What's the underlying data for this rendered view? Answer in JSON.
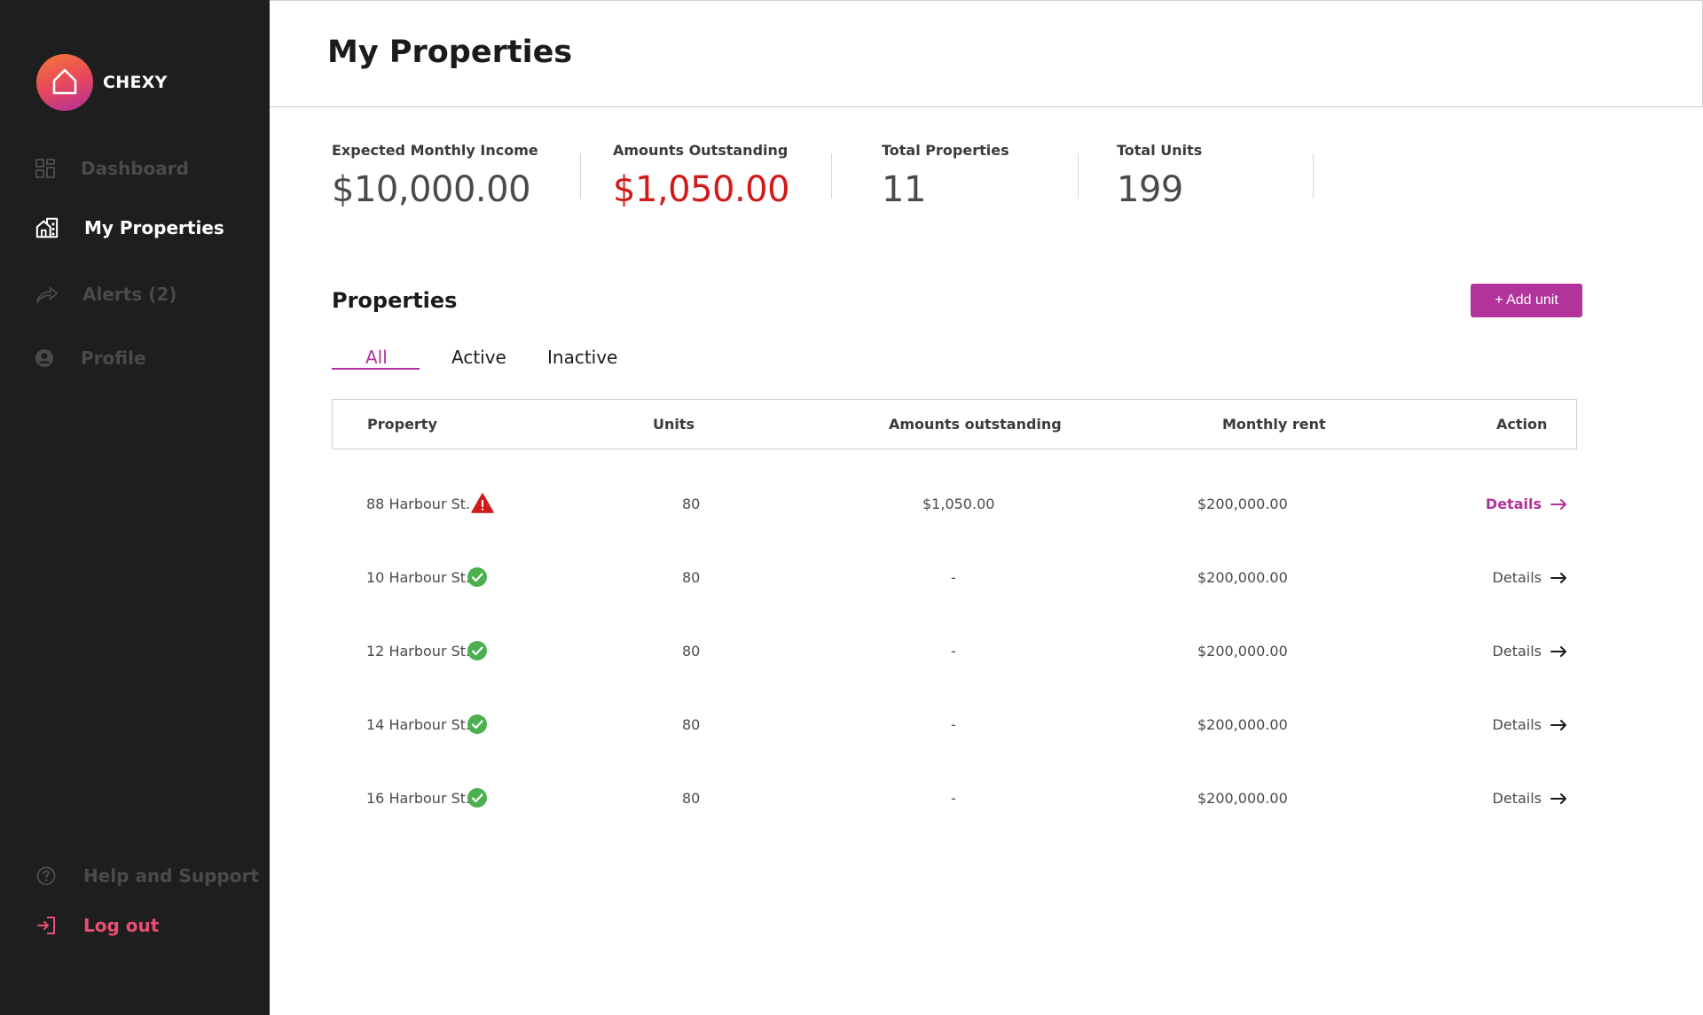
{
  "brand": {
    "name": "CHEXY"
  },
  "sidebar": {
    "items": [
      {
        "label": "Dashboard",
        "icon": "dashboard-icon"
      },
      {
        "label": "My Properties",
        "icon": "building-icon",
        "active": true
      },
      {
        "label": "Alerts (2)",
        "icon": "share-arrow-icon"
      },
      {
        "label": "Profile",
        "icon": "user-icon"
      }
    ],
    "footer": [
      {
        "label": "Help and Support",
        "icon": "help-icon"
      },
      {
        "label": "Log out",
        "icon": "logout-icon"
      }
    ]
  },
  "header": {
    "title": "My Properties"
  },
  "stats": [
    {
      "label": "Expected Monthly Income",
      "value": "$10,000.00"
    },
    {
      "label": "Amounts Outstanding",
      "value": "$1,050.00"
    },
    {
      "label": "Total Properties",
      "value": "11"
    },
    {
      "label": "Total Units",
      "value": "199"
    }
  ],
  "properties": {
    "title": "Properties",
    "add_button": "+ Add unit",
    "tabs": [
      "All",
      "Active",
      "Inactive"
    ],
    "active_tab": "All",
    "columns": [
      "Property",
      "Units",
      "Amounts outstanding",
      "Monthly rent",
      "Action"
    ],
    "rows": [
      {
        "property": "88 Harbour St.",
        "status": "warning",
        "units": "80",
        "outstanding": "$1,050.00",
        "rent": "$200,000.00",
        "action": "Details"
      },
      {
        "property": "10 Harbour St.",
        "status": "ok",
        "units": "80",
        "outstanding": "-",
        "rent": "$200,000.00",
        "action": "Details"
      },
      {
        "property": "12 Harbour St.",
        "status": "ok",
        "units": "80",
        "outstanding": "-",
        "rent": "$200,000.00",
        "action": "Details"
      },
      {
        "property": "14 Harbour St.",
        "status": "ok",
        "units": "80",
        "outstanding": "-",
        "rent": "$200,000.00",
        "action": "Details"
      },
      {
        "property": "16 Harbour St.",
        "status": "ok",
        "units": "80",
        "outstanding": "-",
        "rent": "$200,000.00",
        "action": "Details"
      }
    ]
  },
  "colors": {
    "accent": "#b2339c",
    "sidebar_bg": "#1e1e1e",
    "danger": "#d11a1a",
    "success": "#4caf50",
    "logout": "#ea4e74"
  }
}
